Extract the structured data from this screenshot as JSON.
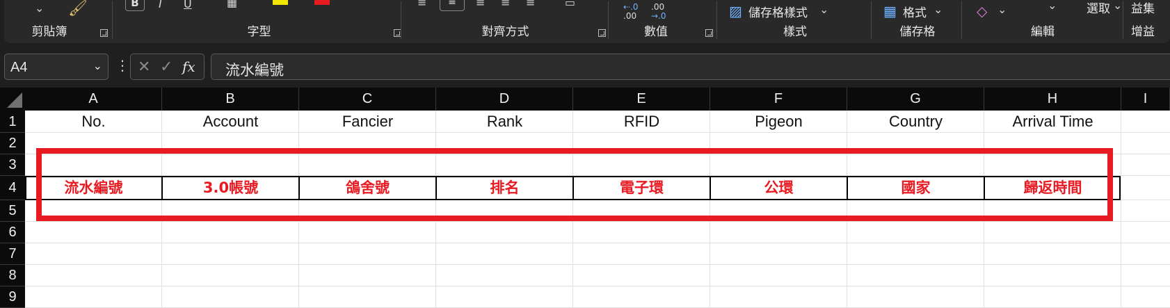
{
  "ribbon": {
    "groups": {
      "clipboard": "剪貼簿",
      "font": "字型",
      "alignment": "對齊方式",
      "number": "數值",
      "styles": "樣式",
      "cells": "儲存格",
      "editing": "編輯",
      "addins": "增益"
    },
    "cell_styles_label": "儲存格樣式",
    "format_label": "格式",
    "select_label": "選取",
    "addins_top": "益集",
    "number_inc_top": ".0",
    "number_inc_bottom": ".00",
    "number_dec_top": ".00",
    "number_dec_bottom": "→.0"
  },
  "formula_bar": {
    "name_box": "A4",
    "fx": "fx",
    "formula": "流水編號"
  },
  "columns": [
    "A",
    "B",
    "C",
    "D",
    "E",
    "F",
    "G",
    "H",
    "I"
  ],
  "rows": [
    "1",
    "2",
    "3",
    "4",
    "5",
    "6",
    "7",
    "8",
    "9"
  ],
  "row1": [
    "No.",
    "Account",
    "Fancier",
    "Rank",
    "RFID",
    "Pigeon",
    "Country",
    "Arrival Time"
  ],
  "row4": [
    "流水編號",
    "3.0帳號",
    "鴿舍號",
    "排名",
    "電子環",
    "公環",
    "國家",
    "歸返時間"
  ],
  "colors": {
    "highlight": "#e81b23",
    "ribbon_bg": "#292929",
    "header_bg": "#0b0b0b"
  }
}
